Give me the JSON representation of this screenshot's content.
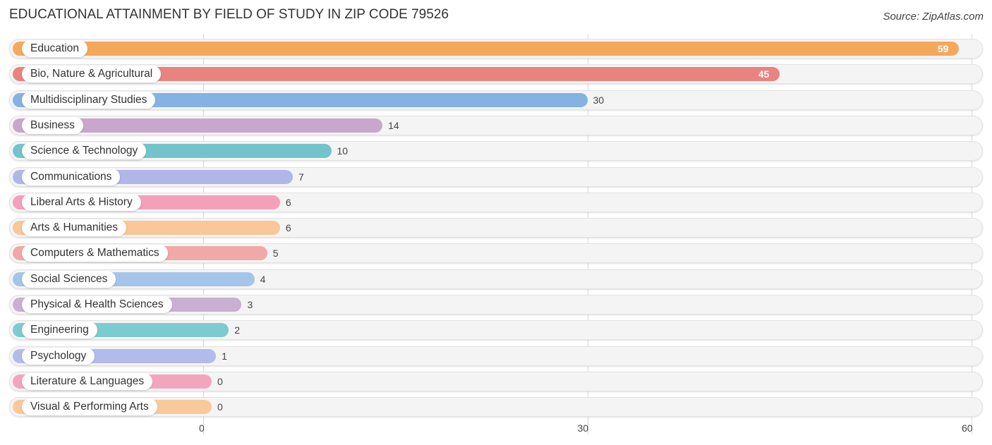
{
  "chart_data": {
    "type": "bar",
    "orientation": "horizontal",
    "title": "EDUCATIONAL ATTAINMENT BY FIELD OF STUDY IN ZIP CODE 79526",
    "source": "Source: ZipAtlas.com",
    "xlabel": "",
    "ylabel": "",
    "xlim": [
      0,
      60
    ],
    "xticks": [
      "0",
      "30",
      "60"
    ],
    "xtick_values": [
      0,
      30,
      60
    ],
    "grid": true,
    "categories": [
      "Education",
      "Bio, Nature & Agricultural",
      "Multidisciplinary Studies",
      "Business",
      "Science & Technology",
      "Communications",
      "Liberal Arts & History",
      "Arts & Humanities",
      "Computers & Mathematics",
      "Social Sciences",
      "Physical & Health Sciences",
      "Engineering",
      "Psychology",
      "Literature & Languages",
      "Visual & Performing Arts"
    ],
    "values": [
      59,
      45,
      30,
      14,
      10,
      7,
      6,
      6,
      5,
      4,
      3,
      2,
      1,
      0,
      0
    ],
    "value_labels": [
      "59",
      "45",
      "30",
      "14",
      "10",
      "7",
      "6",
      "6",
      "5",
      "4",
      "3",
      "2",
      "1",
      "0",
      "0"
    ],
    "colors": [
      "#f6a85a",
      "#e8837f",
      "#83b2e3",
      "#c9a6cc",
      "#72c4ca",
      "#b0b7e8",
      "#f4a0bb",
      "#f9c798",
      "#f0a9a6",
      "#a4c4ea",
      "#c9afd2",
      "#7ccbd0",
      "#b2bbea",
      "#f4a5be",
      "#f9c99c"
    ]
  }
}
